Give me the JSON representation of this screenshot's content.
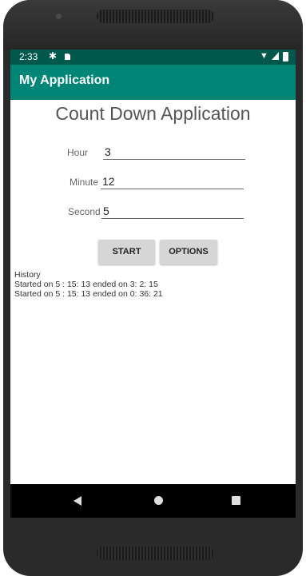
{
  "status_bar": {
    "time": "2:33"
  },
  "app_bar": {
    "title": "My Application"
  },
  "heading": "Count Down Application",
  "form": {
    "hour": {
      "label": "Hour",
      "value": "3"
    },
    "minute": {
      "label": "Minute",
      "value": "12"
    },
    "second": {
      "label": "Second",
      "value": "5"
    }
  },
  "buttons": {
    "start": "START",
    "options": "OPTIONS"
  },
  "history": {
    "title": "History",
    "entries": [
      "Started on 5 : 15: 13 ended on 3: 2: 15",
      "Started on 5 : 15: 13 ended on 0: 36: 21"
    ]
  },
  "colors": {
    "primary": "#008577",
    "primary_dark": "#00574b"
  },
  "icons": {
    "status": [
      "gear-icon",
      "sd-card-icon",
      "wifi-icon",
      "signal-icon",
      "battery-icon"
    ],
    "nav": [
      "back-icon",
      "home-icon",
      "recents-icon"
    ]
  }
}
